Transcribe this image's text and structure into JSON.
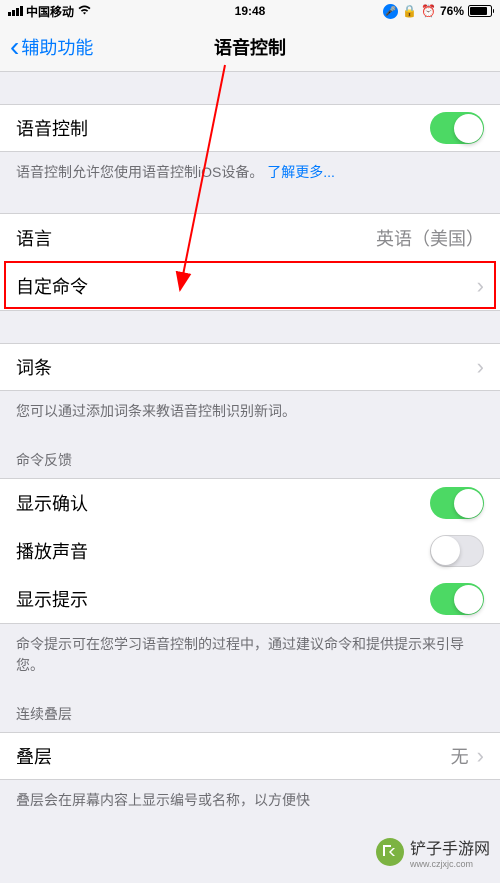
{
  "status": {
    "carrier": "中国移动",
    "time": "19:48",
    "battery_pct": "76%"
  },
  "nav": {
    "back": "辅助功能",
    "title": "语音控制"
  },
  "main_toggle": {
    "label": "语音控制",
    "on": true
  },
  "main_footer": {
    "text": "语音控制允许您使用语音控制iOS设备。",
    "link": "了解更多..."
  },
  "rows": {
    "language": {
      "label": "语言",
      "value": "英语（美国）"
    },
    "custom_commands": {
      "label": "自定命令"
    },
    "vocabulary": {
      "label": "词条"
    }
  },
  "vocab_footer": "您可以通过添加词条来教语音控制识别新词。",
  "feedback_header": "命令反馈",
  "feedback": {
    "confirm": {
      "label": "显示确认",
      "on": true
    },
    "sound": {
      "label": "播放声音",
      "on": false
    },
    "hints": {
      "label": "显示提示",
      "on": true
    }
  },
  "feedback_footer": "命令提示可在您学习语音控制的过程中，通过建议命令和提供提示来引导您。",
  "overlay_header": "连续叠层",
  "overlay": {
    "label": "叠层",
    "value": "无"
  },
  "overlay_footer": "叠层会在屏幕内容上显示编号或名称，以方便快",
  "watermark": {
    "text": "铲子手游网",
    "url": "www.czjxjc.com"
  }
}
